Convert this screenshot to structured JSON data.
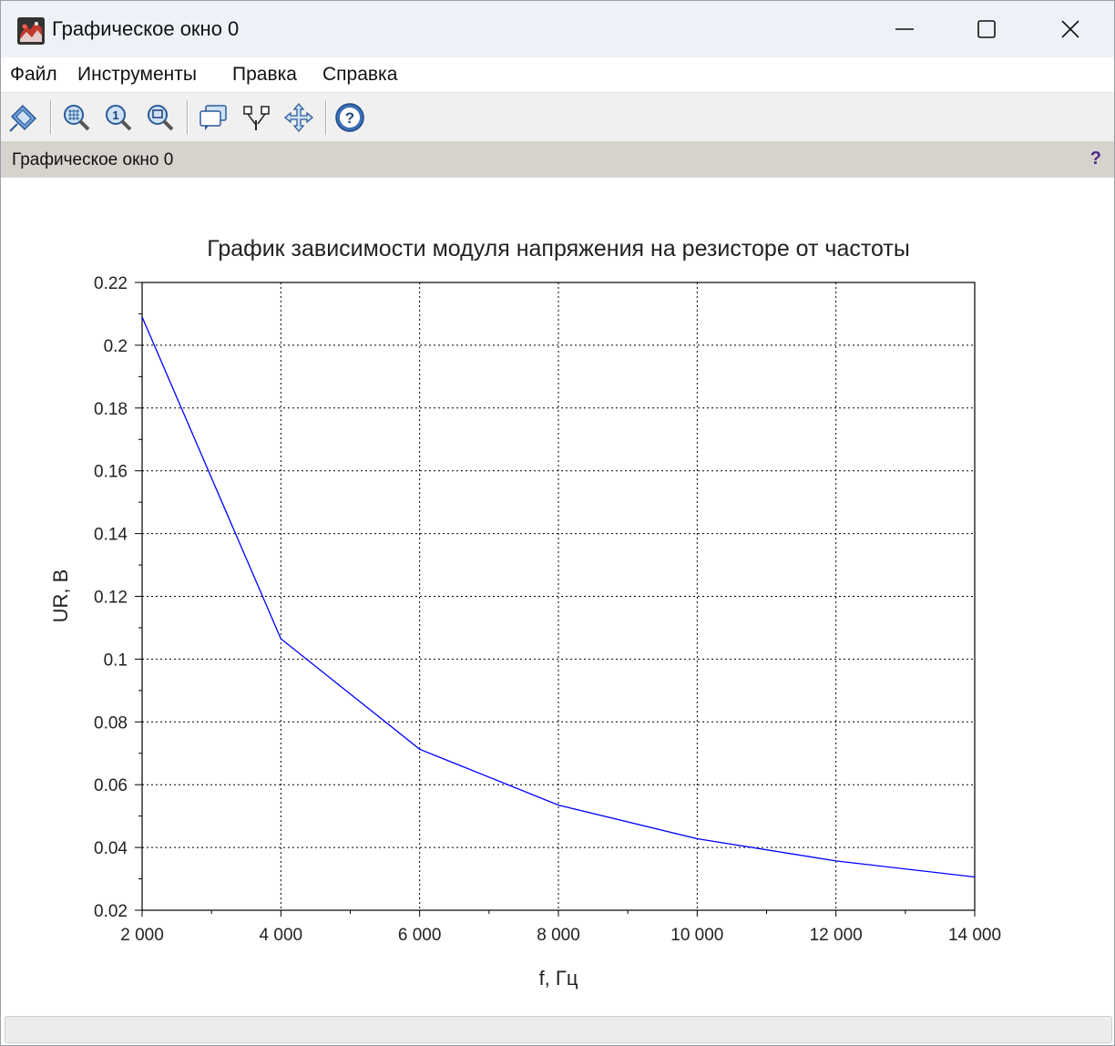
{
  "window": {
    "title": "Графическое окно 0",
    "icon": "scilab-graphics-icon"
  },
  "menu": {
    "items": [
      "Файл",
      "Инструменты",
      "Правка",
      "Справка"
    ]
  },
  "toolbar": {
    "buttons": [
      "datatip-icon",
      "zoom-icon",
      "zoom-original-icon",
      "zoom-area-icon",
      "datatips-icon",
      "rotate-icon",
      "pan-icon",
      "help-icon"
    ]
  },
  "status": {
    "text": "Графическое окно 0",
    "help": "?"
  },
  "colors": {
    "line": "#0000ff",
    "grid": "#000000"
  },
  "chart_data": {
    "type": "line",
    "title": "График зависимости модуля напряжения на резисторе от частоты",
    "xlabel": "f, Гц",
    "ylabel": "UR, В",
    "xlim": [
      2000,
      14000
    ],
    "ylim": [
      0.02,
      0.22
    ],
    "grid": true,
    "xticks": [
      2000,
      4000,
      6000,
      8000,
      10000,
      12000,
      14000
    ],
    "xtick_labels": [
      "2 000",
      "4 000",
      "6 000",
      "8 000",
      "10 000",
      "12 000",
      "14 000"
    ],
    "yticks": [
      0.02,
      0.04,
      0.06,
      0.08,
      0.1,
      0.12,
      0.14,
      0.16,
      0.18,
      0.2,
      0.22
    ],
    "ytick_labels": [
      "0.02",
      "0.04",
      "0.06",
      "0.08",
      "0.1",
      "0.12",
      "0.14",
      "0.16",
      "0.18",
      "0.2",
      "0.22"
    ],
    "series": [
      {
        "x": [
          2000,
          4000,
          6000,
          8000,
          10000,
          12000,
          14000
        ],
        "y": [
          0.209,
          0.1065,
          0.0713,
          0.0535,
          0.0428,
          0.0357,
          0.0306
        ]
      }
    ]
  }
}
